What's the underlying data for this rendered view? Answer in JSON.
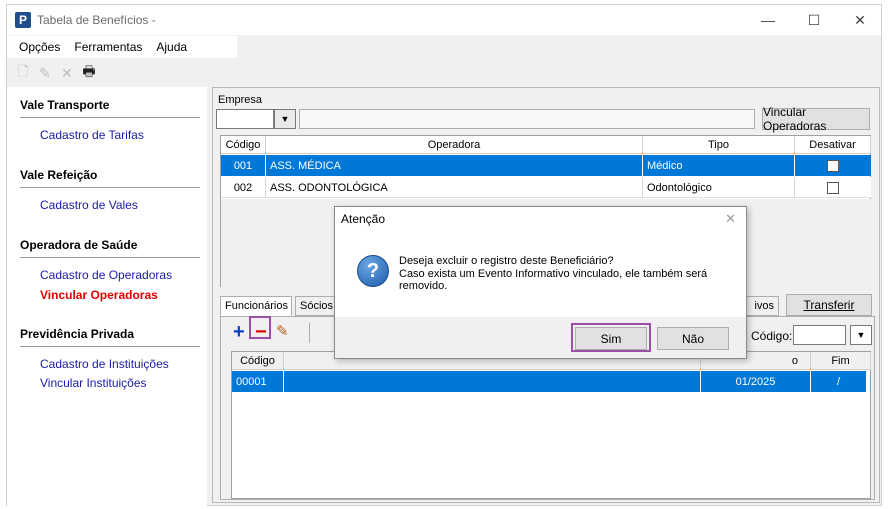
{
  "window": {
    "title": "Tabela de Benefícios -",
    "app_icon_letter": "P",
    "minimize": "—",
    "maximize": "☐",
    "close": "✕"
  },
  "menu": [
    "Opções",
    "Ferramentas",
    "Ajuda"
  ],
  "toolbar": [
    {
      "icon": "new-document-icon",
      "glyph": "🗋"
    },
    {
      "icon": "edit-pencil-icon",
      "glyph": "✎"
    },
    {
      "icon": "delete-x-icon",
      "glyph": "✕"
    },
    {
      "icon": "printer-icon",
      "glyph": "🖶"
    }
  ],
  "nav": {
    "sections": [
      {
        "title": "Vale Transporte",
        "links": [
          {
            "label": "Cadastro de Tarifas",
            "active": false
          }
        ]
      },
      {
        "title": "Vale Refeição",
        "links": [
          {
            "label": "Cadastro de Vales",
            "active": false
          }
        ]
      },
      {
        "title": "Operadora de Saúde",
        "links": [
          {
            "label": "Cadastro de Operadoras",
            "active": false
          },
          {
            "label": "Vincular Operadoras",
            "active": true
          }
        ]
      },
      {
        "title": "Previdência Privada",
        "links": [
          {
            "label": "Cadastro de Instituições",
            "active": false
          },
          {
            "label": "Vincular Instituições",
            "active": false
          }
        ]
      }
    ]
  },
  "empresa": {
    "label": "Empresa",
    "value": "",
    "dropdown": "▼",
    "vincular_button": "Vincular Operadoras"
  },
  "operadoras_grid": {
    "columns": [
      "Código",
      "Operadora",
      "Tipo",
      "Desativar"
    ],
    "rows": [
      {
        "codigo": "001",
        "operadora": "ASS. MÉDICA",
        "tipo": "Médico",
        "selected": true
      },
      {
        "codigo": "002",
        "operadora": "ASS. ODONTOLÓGICA",
        "tipo": "Odontológico",
        "selected": false
      }
    ]
  },
  "tabs": {
    "funcionarios": "Funcionários",
    "socios": "Sócios",
    "ativos": "ivos",
    "transferir": "Transferir"
  },
  "lower": {
    "add_glyph": "+",
    "remove_glyph": "−",
    "edit_glyph": "✎",
    "codigo_label": "Código:",
    "codigo_value": "",
    "dropdown": "▼",
    "columns": [
      "Código",
      "o",
      "Fim"
    ],
    "rows": [
      {
        "codigo": "00001",
        "inicio": "01/2025",
        "fim": "/",
        "selected": true
      }
    ]
  },
  "dialog": {
    "title": "Atenção",
    "close": "✕",
    "question_glyph": "?",
    "message": "Deseja excluir o registro deste Beneficiário?\nCaso exista um Evento Informativo vinculado, ele também será\nremovido.",
    "yes_label": "Sim",
    "no_label": "Não"
  },
  "colors": {
    "selection": "#0078d7",
    "highlight": "#9b4fa7",
    "link": "#1a1aa6",
    "active_link": "#e00000"
  }
}
